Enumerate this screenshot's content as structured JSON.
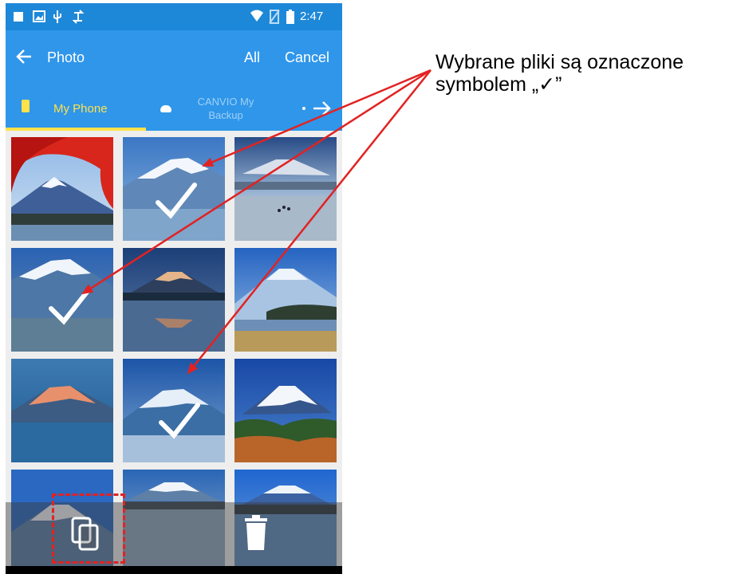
{
  "status_bar": {
    "time": "2:47",
    "icons": [
      "stop-icon",
      "image-icon",
      "usb-icon",
      "sync-icon",
      "wifi-icon",
      "no-sim-icon",
      "battery-icon"
    ]
  },
  "app_bar": {
    "title": "Photo",
    "all_label": "All",
    "cancel_label": "Cancel",
    "back_icon": "arrow-left-icon"
  },
  "tabs": [
    {
      "label": "My Phone",
      "icon": "phone-icon",
      "selected": true
    },
    {
      "label": "CANVIO My Backup",
      "icon": "drive-icon",
      "selected": false
    }
  ],
  "tab_next_icon": "arrow-right-icon",
  "photos": [
    {
      "name": "photo-1",
      "selected": false
    },
    {
      "name": "photo-2",
      "selected": true
    },
    {
      "name": "photo-3",
      "selected": false
    },
    {
      "name": "photo-4",
      "selected": true
    },
    {
      "name": "photo-5",
      "selected": false
    },
    {
      "name": "photo-6",
      "selected": false
    },
    {
      "name": "photo-7",
      "selected": false
    },
    {
      "name": "photo-8",
      "selected": true
    },
    {
      "name": "photo-9",
      "selected": false
    },
    {
      "name": "photo-10",
      "selected": false
    },
    {
      "name": "photo-11",
      "selected": false
    },
    {
      "name": "photo-12",
      "selected": false
    }
  ],
  "bottom_bar": {
    "copy_icon": "copy-icon",
    "delete_icon": "trash-icon"
  },
  "annotation": {
    "text": "Wybrane pliki są oznaczone symbolem „✓”",
    "color": "#e22222"
  },
  "colors": {
    "status_bar": "#1e88d8",
    "app_bar": "#2f96ea",
    "tab_active": "#ffe24a",
    "tab_inactive_text": "#9fd0f5",
    "annotation_red": "#e22222"
  }
}
